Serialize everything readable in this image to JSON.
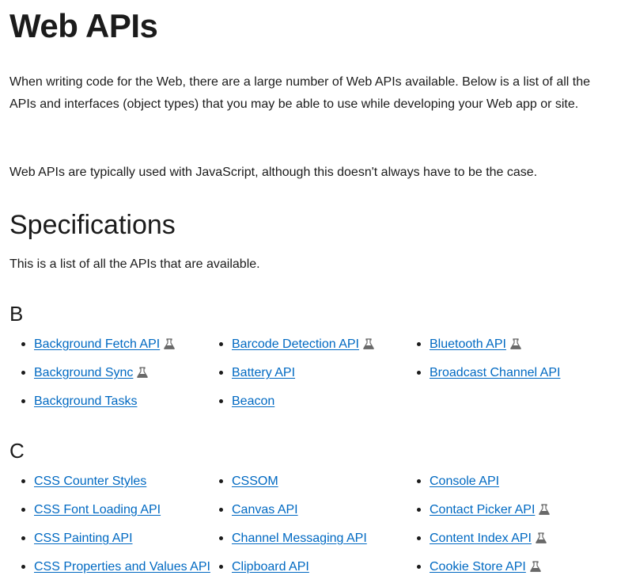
{
  "page": {
    "title": "Web APIs",
    "intro": "When writing code for the Web, there are a large number of Web APIs available. Below is a list of all the APIs and interfaces (object types) that you may be able to use while developing your Web app or site.",
    "intro2": "Web APIs are typically used with JavaScript, although this doesn't always have to be the case.",
    "specs_heading": "Specifications",
    "specs_intro": "This is a list of all the APIs that are available."
  },
  "colors": {
    "link": "#0069c2",
    "text": "#1b1b1b",
    "experimental_icon": "#696969"
  },
  "sections": [
    {
      "letter": "B",
      "columns": [
        [
          {
            "label": "Background Fetch API",
            "experimental": true
          },
          {
            "label": "Background Sync",
            "experimental": true
          },
          {
            "label": "Background Tasks",
            "experimental": false
          }
        ],
        [
          {
            "label": "Barcode Detection API",
            "experimental": true
          },
          {
            "label": "Battery API",
            "experimental": false
          },
          {
            "label": "Beacon",
            "experimental": false
          }
        ],
        [
          {
            "label": "Bluetooth API",
            "experimental": true
          },
          {
            "label": "Broadcast Channel API",
            "experimental": false
          }
        ]
      ]
    },
    {
      "letter": "C",
      "columns": [
        [
          {
            "label": "CSS Counter Styles",
            "experimental": false
          },
          {
            "label": "CSS Font Loading API",
            "experimental": false
          },
          {
            "label": "CSS Painting API",
            "experimental": false
          },
          {
            "label": "CSS Properties and Values API",
            "experimental": false
          }
        ],
        [
          {
            "label": "CSSOM",
            "experimental": false
          },
          {
            "label": "Canvas API",
            "experimental": false
          },
          {
            "label": "Channel Messaging API",
            "experimental": false
          },
          {
            "label": "Clipboard API",
            "experimental": false
          }
        ],
        [
          {
            "label": "Console API",
            "experimental": false
          },
          {
            "label": "Contact Picker API",
            "experimental": true
          },
          {
            "label": "Content Index API",
            "experimental": true
          },
          {
            "label": "Cookie Store API",
            "experimental": true
          }
        ]
      ]
    }
  ]
}
